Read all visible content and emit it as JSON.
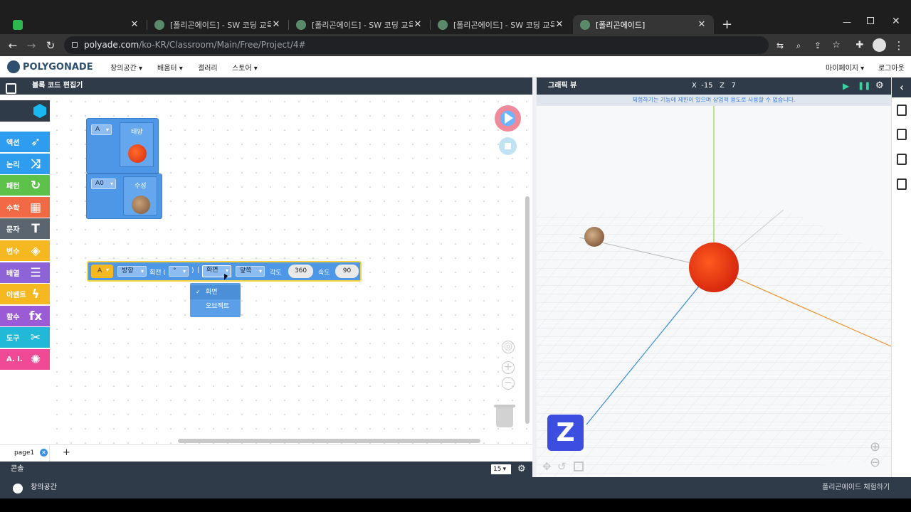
{
  "browser": {
    "tabs": [
      {
        "title": ""
      },
      {
        "title": "[폴리곤에이드] - SW 코딩 교육"
      },
      {
        "title": "[폴리곤에이드] - SW 코딩 교육"
      },
      {
        "title": "[폴리곤에이드] - SW 코딩 교육"
      },
      {
        "title": "[폴리곤에이드]"
      }
    ],
    "url_host": "polyade.com",
    "url_path": "/ko-KR/Classroom/Main/Free/Project/4#"
  },
  "site": {
    "logo": "POLYGONADE",
    "nav": [
      "창의공간 ▾",
      "배움터 ▾",
      "갤러리",
      "스토어 ▾"
    ],
    "mypage": "마이페이지 ▾",
    "logout": "로그아웃"
  },
  "editor": {
    "title": "블록 코드 편집기",
    "categories": [
      {
        "label": "액션",
        "color": "#2e9df0",
        "icon": "rocket-icon",
        "glyph": "➶"
      },
      {
        "label": "논리",
        "color": "#2e9df0",
        "icon": "shuffle-icon",
        "glyph": "⤨"
      },
      {
        "label": "패턴",
        "color": "#5cc24a",
        "icon": "loop-icon",
        "glyph": "↻"
      },
      {
        "label": "수학",
        "color": "#f26a45",
        "icon": "calculator-icon",
        "glyph": "▦"
      },
      {
        "label": "문자",
        "color": "#5a6570",
        "icon": "text-icon",
        "glyph": "T"
      },
      {
        "label": "변수",
        "color": "#f5b820",
        "icon": "box-icon",
        "glyph": "◈"
      },
      {
        "label": "배열",
        "color": "#8e63d8",
        "icon": "list-icon",
        "glyph": "☰"
      },
      {
        "label": "이벤트",
        "color": "#f5b820",
        "icon": "lightning-icon",
        "glyph": "ϟ"
      },
      {
        "label": "함수",
        "color": "#9c5bd6",
        "icon": "function-icon",
        "glyph": "fx"
      },
      {
        "label": "도구",
        "color": "#22b8d8",
        "icon": "tools-icon",
        "glyph": "✂"
      },
      {
        "label": "A. I.",
        "color": "#f04a96",
        "icon": "ai-icon",
        "glyph": "✺"
      }
    ],
    "blocks": {
      "a_select": "A",
      "sun_label": "태양",
      "a0_select": "A0",
      "mercury_label": "수성",
      "rotate_var": "A",
      "direction": "방향",
      "rotate_word": "회전 (",
      "degree_unit": "°",
      "paren_close": ")",
      "separator": "|",
      "frame": "화면",
      "dir_front": "앞쪽",
      "angle_label": "각도",
      "angle_value": "360",
      "speed_label": "속도",
      "speed_value": "90"
    },
    "dropdown": {
      "items": [
        "화면",
        "오브젝트"
      ],
      "checked_mark": "✓"
    },
    "page_tab": "page1",
    "add_page": "+",
    "console": "콘솔",
    "console_size": "15"
  },
  "graphic": {
    "title": "그래픽 뷰",
    "coords": "X  -15   Z   7",
    "notice": "체험하기는 기능에 제한이 있으며 상업적 용도로 사용할 수 없습니다.",
    "z_badge": "Z"
  },
  "status": {
    "left": "창의공간",
    "right": "폴리곤에이드 체험하기"
  },
  "colors": {
    "accent": "#4d97e6",
    "dark": "#2f3b48",
    "z_badge": "#3c4ee0"
  }
}
